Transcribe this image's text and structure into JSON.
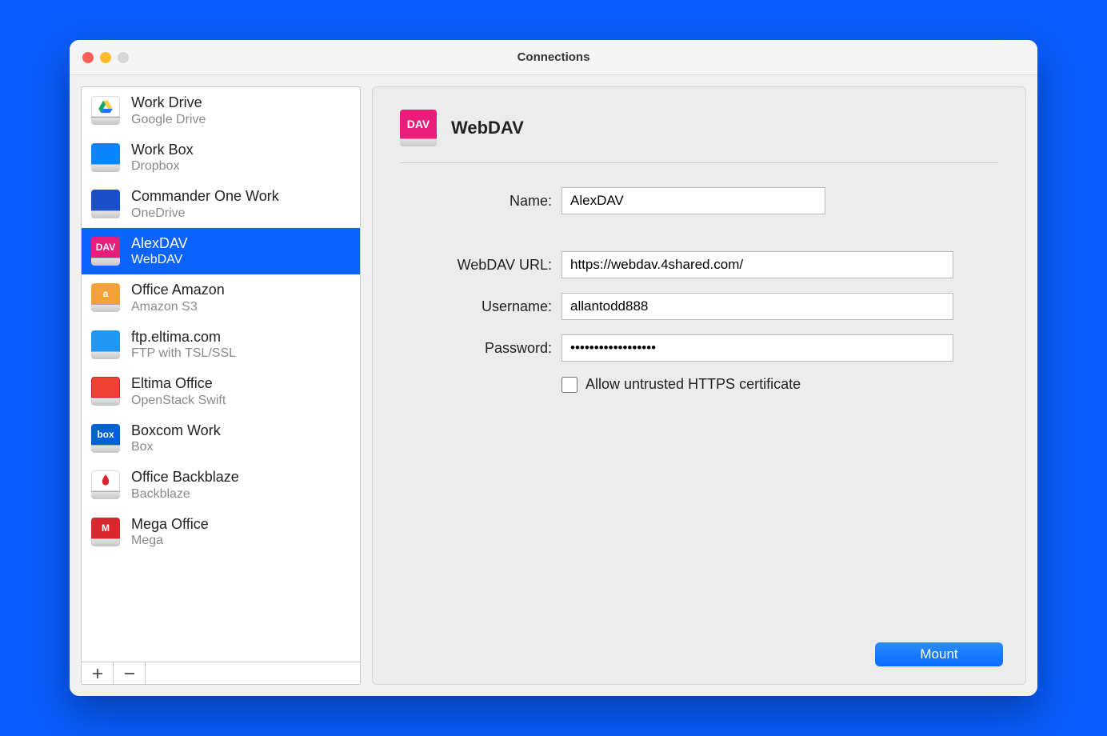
{
  "window": {
    "title": "Connections"
  },
  "sidebar": {
    "items": [
      {
        "name": "Work Drive",
        "sub": "Google Drive",
        "icon": "gdrive"
      },
      {
        "name": "Work Box",
        "sub": "Dropbox",
        "icon": "dropbox"
      },
      {
        "name": "Commander One Work",
        "sub": "OneDrive",
        "icon": "onedrive"
      },
      {
        "name": "AlexDAV",
        "sub": "WebDAV",
        "icon": "webdav",
        "selected": true
      },
      {
        "name": "Office Amazon",
        "sub": "Amazon S3",
        "icon": "amazon"
      },
      {
        "name": "ftp.eltima.com",
        "sub": "FTP with TSL/SSL",
        "icon": "ftp"
      },
      {
        "name": "Eltima Office",
        "sub": "OpenStack Swift",
        "icon": "openstack"
      },
      {
        "name": "Boxcom Work",
        "sub": "Box",
        "icon": "box"
      },
      {
        "name": "Office Backblaze",
        "sub": "Backblaze",
        "icon": "backblaze"
      },
      {
        "name": "Mega Office",
        "sub": "Mega",
        "icon": "mega"
      }
    ]
  },
  "detail": {
    "title": "WebDAV",
    "labels": {
      "name": "Name:",
      "url": "WebDAV URL:",
      "username": "Username:",
      "password": "Password:",
      "allow_untrusted": "Allow untrusted HTTPS certificate"
    },
    "values": {
      "name": "AlexDAV",
      "url": "https://webdav.4shared.com/",
      "username": "allantodd888",
      "password": "••••••••••••••••••",
      "allow_untrusted": false
    },
    "mount_label": "Mount"
  },
  "icon_text": {
    "webdav": "DAV",
    "amazon": "a",
    "box": "box",
    "mega": "M",
    "dropbox": "",
    "onedrive": "",
    "ftp": "",
    "openstack": "",
    "backblaze": "",
    "gdrive": ""
  }
}
